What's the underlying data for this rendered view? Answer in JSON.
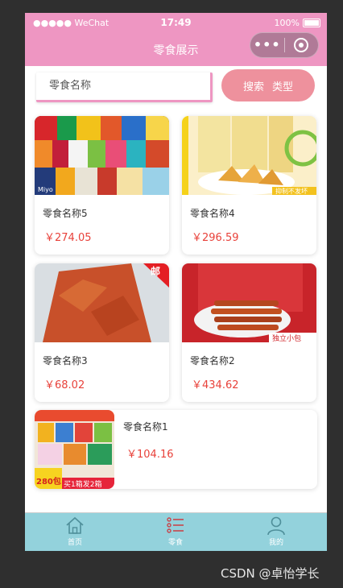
{
  "status_bar": {
    "carrier": "●●●●● WeChat",
    "time": "17:49",
    "battery": "100%"
  },
  "nav": {
    "title": "零食展示"
  },
  "search": {
    "placeholder": "零食名称",
    "button_label_1": "搜索",
    "button_label_2": "类型"
  },
  "products": [
    {
      "name": "零食名称5",
      "price": "￥274.05"
    },
    {
      "name": "零食名称4",
      "price": "￥296.59"
    },
    {
      "name": "零食名称3",
      "price": "￥68.02"
    },
    {
      "name": "零食名称2",
      "price": "￥434.62"
    },
    {
      "name": "零食名称1",
      "price": "￥104.16"
    }
  ],
  "image_texts": {
    "snack_badge": "邮",
    "promo_corner": "独立小包",
    "promo_tag": "抑制不发坏",
    "pack_logo": "Miyo",
    "promo_count": "280包",
    "promo_deal": "买1箱发2箱"
  },
  "tabs": [
    {
      "label": "首页",
      "icon": "home-icon"
    },
    {
      "label": "零食",
      "icon": "list-icon"
    },
    {
      "label": "我的",
      "icon": "user-icon"
    }
  ],
  "colors": {
    "header_pink": "#ee96c2",
    "button_pink": "#ee919d",
    "price_red": "#e8413a",
    "tabbar_cyan": "#93d2dc"
  },
  "watermark": "CSDN @卓怡学长"
}
